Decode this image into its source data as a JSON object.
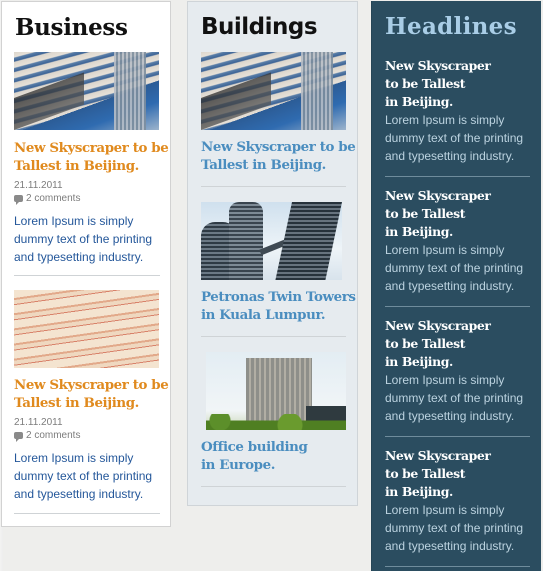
{
  "business": {
    "title": "Business",
    "posts": [
      {
        "image": "skyscraper-photo",
        "title_line1": "New Skyscraper to be",
        "title_line2": "Tallest in Beijing.",
        "date": "21.11.2011",
        "comments": "2 comments",
        "excerpt_line1": "Lorem Ipsum is simply",
        "excerpt_line2": "dummy text of the printing",
        "excerpt_line3": "and typesetting industry."
      },
      {
        "image": "euro-banknotes-photo",
        "title_line1": "New Skyscraper to be",
        "title_line2": "Tallest in Beijing.",
        "date": "21.11.2011",
        "comments": "2 comments",
        "excerpt_line1": "Lorem Ipsum is simply",
        "excerpt_line2": "dummy text of the printing",
        "excerpt_line3": "and typesetting industry."
      }
    ]
  },
  "buildings": {
    "title": "Buildings",
    "posts": [
      {
        "image": "skyscraper-photo",
        "title_line1": "New Skyscraper to be",
        "title_line2": "Tallest in Beijing."
      },
      {
        "image": "petronas-towers-photo",
        "title_line1": "Petronas Twin Towers",
        "title_line2": "in Kuala Lumpur."
      },
      {
        "image": "office-building-photo",
        "title_line1": "Office building",
        "title_line2": "in Europe."
      }
    ]
  },
  "headlines": {
    "title": "Headlines",
    "items": [
      {
        "title_line1": "New Skyscraper",
        "title_line2": "to be Tallest",
        "title_line3": "in Beijing.",
        "excerpt_line1": "Lorem Ipsum is simply",
        "excerpt_line2": "dummy text of the printing",
        "excerpt_line3": "and typesetting industry."
      },
      {
        "title_line1": "New Skyscraper",
        "title_line2": "to be Tallest",
        "title_line3": "in Beijing.",
        "excerpt_line1": "Lorem Ipsum is simply",
        "excerpt_line2": "dummy text of the printing",
        "excerpt_line3": "and typesetting industry."
      },
      {
        "title_line1": "New Skyscraper",
        "title_line2": "to be Tallest",
        "title_line3": "in Beijing.",
        "excerpt_line1": "Lorem Ipsum is simply",
        "excerpt_line2": "dummy text of the printing",
        "excerpt_line3": "and typesetting industry."
      },
      {
        "title_line1": "New Skyscraper",
        "title_line2": "to be Tallest",
        "title_line3": "in Beijing.",
        "excerpt_line1": "Lorem Ipsum is simply",
        "excerpt_line2": "dummy text of the printing",
        "excerpt_line3": "and typesetting industry."
      }
    ]
  },
  "colors": {
    "business_link": "#e08a1e",
    "buildings_link": "#4a8dbf",
    "excerpt_text": "#24579a",
    "headlines_bg": "#2b4d60",
    "headlines_title": "#a9cde6"
  }
}
